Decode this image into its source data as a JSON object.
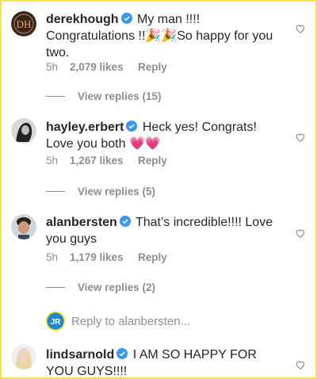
{
  "comments": [
    {
      "username": "derekhough",
      "text": "My man !!!! Congratulations !!🎉🎉So happy for you two.",
      "time": "5h",
      "likes": "2,079 likes",
      "reply": "Reply",
      "view_replies": "View replies (15)"
    },
    {
      "username": "hayley.erbert",
      "text": "Heck yes! Congrats! Love you both 💗💗",
      "time": "5h",
      "likes": "1,267 likes",
      "reply": "Reply",
      "view_replies": "View replies (5)"
    },
    {
      "username": "alanbersten",
      "text": "That’s incredible!!!! Love you guys",
      "time": "5h",
      "likes": "1,179 likes",
      "reply": "Reply",
      "view_replies": "View replies (2)"
    },
    {
      "username": "lindsarnold",
      "text": "I AM SO HAPPY FOR YOU GUYS!!!!"
    }
  ],
  "reply_to": {
    "avatar_text": "JR",
    "placeholder": "Reply to alanbersten..."
  },
  "icons": {
    "verified": "verified-badge-icon",
    "like": "heart-outline-icon"
  },
  "colors": {
    "verified_blue": "#3897f0",
    "muted_text": "#8e8e8e",
    "text": "#262626",
    "frame_yellow": "#f2e34c"
  }
}
